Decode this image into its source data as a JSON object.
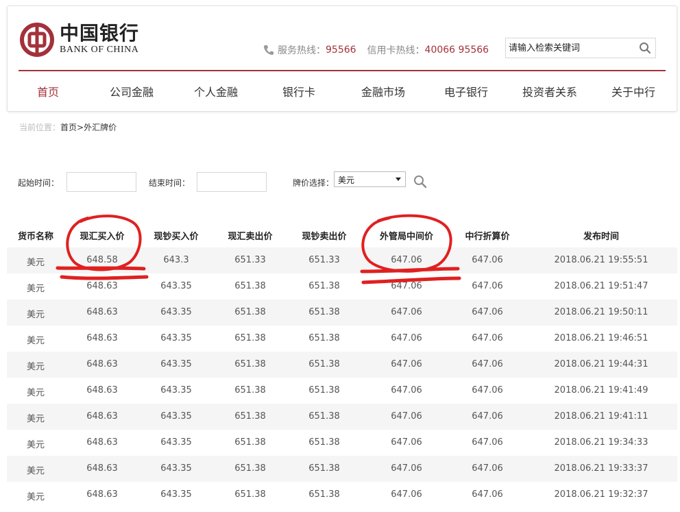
{
  "header": {
    "logo_cn": "中国银行",
    "logo_en": "BANK OF CHINA",
    "service_label": "服务热线：",
    "service_number": "95566",
    "card_label": "信用卡热线：",
    "card_number": "40066 95566",
    "search_placeholder": "请输入检索关键词",
    "brand_color": "#a3313b"
  },
  "nav": {
    "items": [
      "首页",
      "公司金融",
      "个人金融",
      "银行卡",
      "金融市场",
      "电子银行",
      "投资者关系",
      "关于中行"
    ],
    "active_index": 0
  },
  "breadcrumb": {
    "prefix": "当前位置：",
    "path": "首页>外汇牌价"
  },
  "filters": {
    "start_label": "起始时间：",
    "end_label": "结束时间：",
    "currency_label": "牌价选择：",
    "currency_selected": "美元"
  },
  "table": {
    "columns": [
      "货币名称",
      "现汇买入价",
      "现钞买入价",
      "现汇卖出价",
      "现钞卖出价",
      "外管局中间价",
      "中行折算价",
      "发布时间"
    ],
    "rows": [
      [
        "美元",
        "648.58",
        "643.3",
        "651.33",
        "651.33",
        "647.06",
        "647.06",
        "2018.06.21 19:55:51"
      ],
      [
        "美元",
        "648.63",
        "643.35",
        "651.38",
        "651.38",
        "647.06",
        "647.06",
        "2018.06.21 19:51:47"
      ],
      [
        "美元",
        "648.63",
        "643.35",
        "651.38",
        "651.38",
        "647.06",
        "647.06",
        "2018.06.21 19:50:11"
      ],
      [
        "美元",
        "648.63",
        "643.35",
        "651.38",
        "651.38",
        "647.06",
        "647.06",
        "2018.06.21 19:46:51"
      ],
      [
        "美元",
        "648.63",
        "643.35",
        "651.38",
        "651.38",
        "647.06",
        "647.06",
        "2018.06.21 19:44:31"
      ],
      [
        "美元",
        "648.63",
        "643.35",
        "651.38",
        "651.38",
        "647.06",
        "647.06",
        "2018.06.21 19:41:49"
      ],
      [
        "美元",
        "648.63",
        "643.35",
        "651.38",
        "651.38",
        "647.06",
        "647.06",
        "2018.06.21 19:41:11"
      ],
      [
        "美元",
        "648.63",
        "643.35",
        "651.38",
        "651.38",
        "647.06",
        "647.06",
        "2018.06.21 19:34:33"
      ],
      [
        "美元",
        "648.63",
        "643.35",
        "651.38",
        "651.38",
        "647.06",
        "647.06",
        "2018.06.21 19:33:37"
      ],
      [
        "美元",
        "648.63",
        "643.35",
        "651.38",
        "651.38",
        "647.06",
        "647.06",
        "2018.06.21 19:32:37"
      ]
    ]
  },
  "annotations": {
    "marker_color": "#e02020",
    "circled_columns": [
      "现汇买入价",
      "外管局中间价"
    ]
  }
}
